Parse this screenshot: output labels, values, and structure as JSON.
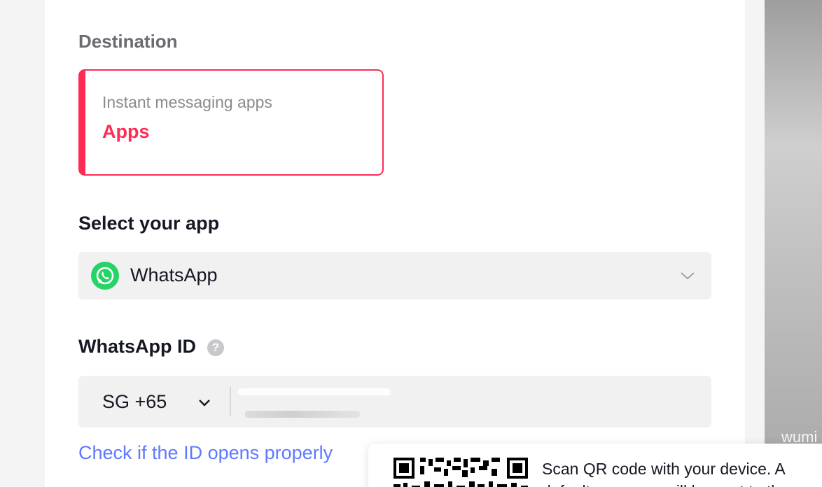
{
  "destination": {
    "section_label": "Destination",
    "card_subtitle": "Instant messaging apps",
    "card_title": "Apps"
  },
  "select_app": {
    "label": "Select your app",
    "selected_value": "WhatsApp"
  },
  "whatsapp_id": {
    "label": "WhatsApp ID",
    "country_code": "SG +65"
  },
  "link_text": "Check if the ID opens properly",
  "qr_popup": {
    "text": "Scan QR code with your device. A default message will be sent to th"
  },
  "watermark": "wumi",
  "colors": {
    "accent": "#fe2c55",
    "link": "#5f79ff",
    "whatsapp": "#25d366"
  }
}
